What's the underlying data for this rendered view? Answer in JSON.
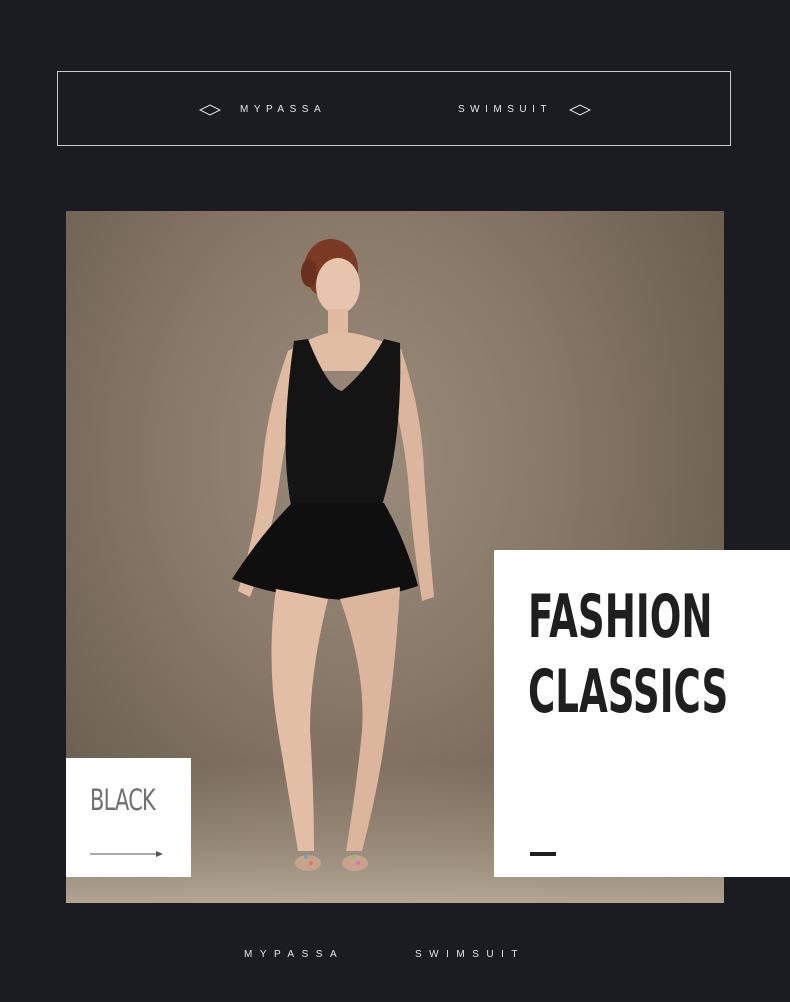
{
  "header": {
    "brand": "MYPASSA",
    "product": "SWIMSUIT",
    "icons": [
      "diamond-icon",
      "diamond-icon"
    ]
  },
  "photo": {
    "subject": "model-in-black-swim-dress"
  },
  "color_card": {
    "label": "BLACK",
    "icon": "arrow-right-icon"
  },
  "headline_card": {
    "line1": "FASHION",
    "line2": "CLASSICS"
  },
  "footer": {
    "brand": "MYPASSA",
    "product": "SWIMSUIT"
  },
  "colors": {
    "background": "#1b1c21",
    "accent_text": "#e6e6e6",
    "card": "#ffffff",
    "headline": "#1f1f1f"
  }
}
